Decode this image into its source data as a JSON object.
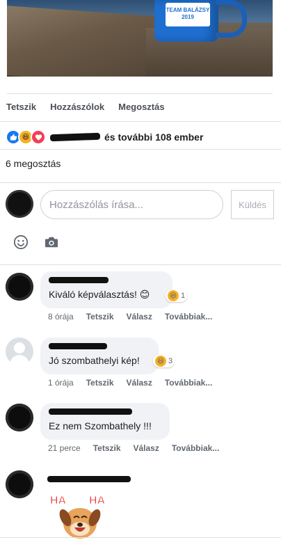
{
  "post_image": {
    "mug_text": "TEAM BALÁZSY\n2019",
    "mug_color": "#1f6fd1"
  },
  "actions": {
    "like": "Tetszik",
    "comment": "Hozzászólok",
    "share": "Megosztás"
  },
  "reactions": {
    "summary": "és további 108 ember",
    "types": [
      "like",
      "haha",
      "love"
    ]
  },
  "shares": {
    "text": "6 megosztás"
  },
  "composer": {
    "placeholder": "Hozzászólás írása...",
    "send_label": "Küldés"
  },
  "comments": [
    {
      "text": "Kiváló képválasztás! 😊",
      "reaction_count": "1",
      "time": "8 órája",
      "like": "Tetszik",
      "reply": "Válasz",
      "more": "Továbbiak..."
    },
    {
      "text": "Jó szombathelyi kép!",
      "reaction_count": "3",
      "time": "1 órája",
      "like": "Tetszik",
      "reply": "Válasz",
      "more": "Továbbiak..."
    },
    {
      "text": "Ez nem Szombathely !!!",
      "time": "21 perce",
      "like": "Tetszik",
      "reply": "Válasz",
      "more": "Továbbiak..."
    },
    {
      "sticker_text": "HA HA"
    }
  ],
  "colors": {
    "accent": "#1877f2",
    "muted": "#65676b",
    "bubble": "#f0f2f5"
  }
}
